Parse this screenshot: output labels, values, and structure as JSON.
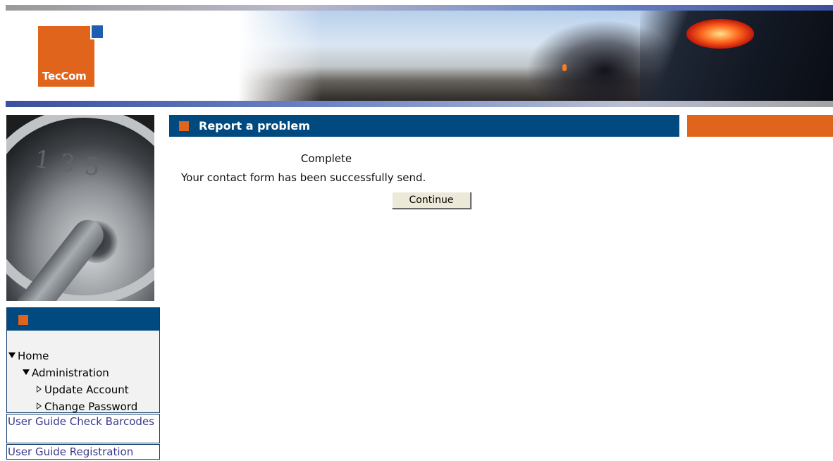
{
  "header": {
    "logo_text": "TecCom"
  },
  "colors": {
    "brand_orange": "#e0641c",
    "brand_blue": "#004a80",
    "logo_square": "#1e5eb1",
    "link_text": "#3a3a8c"
  },
  "page": {
    "title": "Report a problem",
    "status": "Complete",
    "message": "Your contact form has been successfully send.",
    "continue_label": "Continue"
  },
  "nav": {
    "items": [
      {
        "label": "Home",
        "icon": "expanded-triangle-icon"
      },
      {
        "label": "Administration",
        "icon": "expanded-triangle-icon"
      },
      {
        "label": "Update Account",
        "icon": "collapsed-triangle-icon"
      },
      {
        "label": "Change Password",
        "icon": "collapsed-triangle-icon"
      }
    ]
  },
  "links": {
    "user_guide_check_barcodes": "User Guide Check Barcodes",
    "user_guide_registration": "User Guide Registration"
  }
}
